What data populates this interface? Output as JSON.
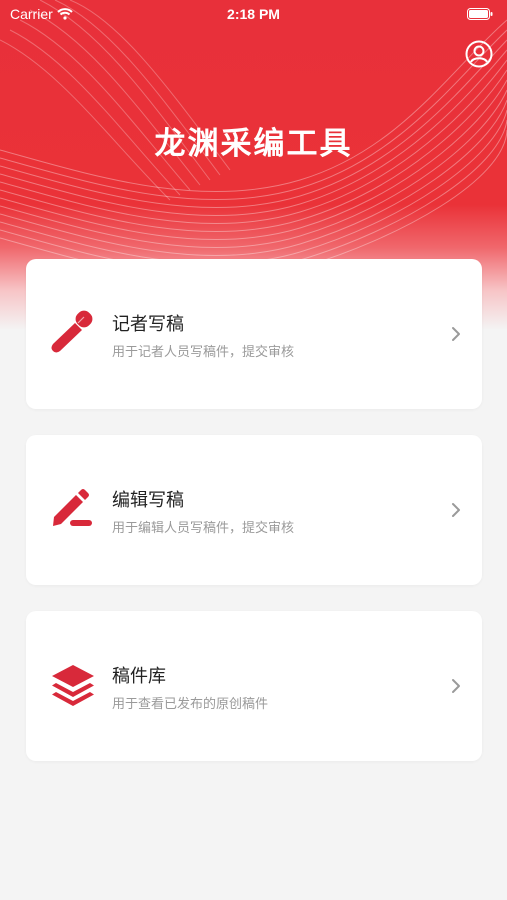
{
  "status_bar": {
    "carrier": "Carrier",
    "time": "2:18 PM"
  },
  "header": {
    "title": "龙渊采编工具"
  },
  "colors": {
    "brand_red": "#e8303a",
    "icon_red": "#d8293a",
    "subtitle_gray": "#9a9a9a"
  },
  "cards": [
    {
      "icon": "microphone-icon",
      "title": "记者写稿",
      "subtitle": "用于记者人员写稿件，提交审核"
    },
    {
      "icon": "edit-pencil-icon",
      "title": "编辑写稿",
      "subtitle": "用于编辑人员写稿件，提交审核"
    },
    {
      "icon": "layers-icon",
      "title": "稿件库",
      "subtitle": "用于查看已发布的原创稿件"
    }
  ]
}
